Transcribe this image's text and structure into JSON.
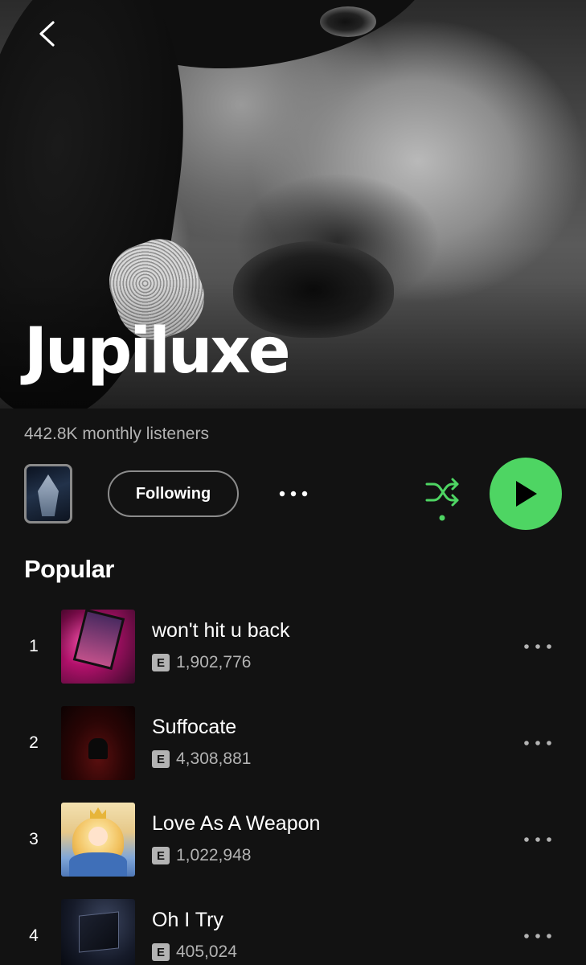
{
  "artist": {
    "name": "Jupiluxe",
    "listeners": "442.8K monthly listeners"
  },
  "actions": {
    "following_label": "Following"
  },
  "popular": {
    "title": "Popular",
    "tracks": [
      {
        "rank": "1",
        "title": "won't hit u back",
        "explicit": "E",
        "plays": "1,902,776"
      },
      {
        "rank": "2",
        "title": "Suffocate",
        "explicit": "E",
        "plays": "4,308,881"
      },
      {
        "rank": "3",
        "title": "Love As A Weapon",
        "explicit": "E",
        "plays": "1,022,948"
      },
      {
        "rank": "4",
        "title": "Oh I Try",
        "explicit": "E",
        "plays": "405,024"
      }
    ]
  },
  "colors": {
    "background": "#121212",
    "accent_green": "#4ed563",
    "secondary_text": "#b3b3b3"
  },
  "icons": {
    "back": "chevron-left-icon",
    "more": "more-horizontal-icon",
    "shuffle": "shuffle-icon",
    "play": "play-icon"
  }
}
